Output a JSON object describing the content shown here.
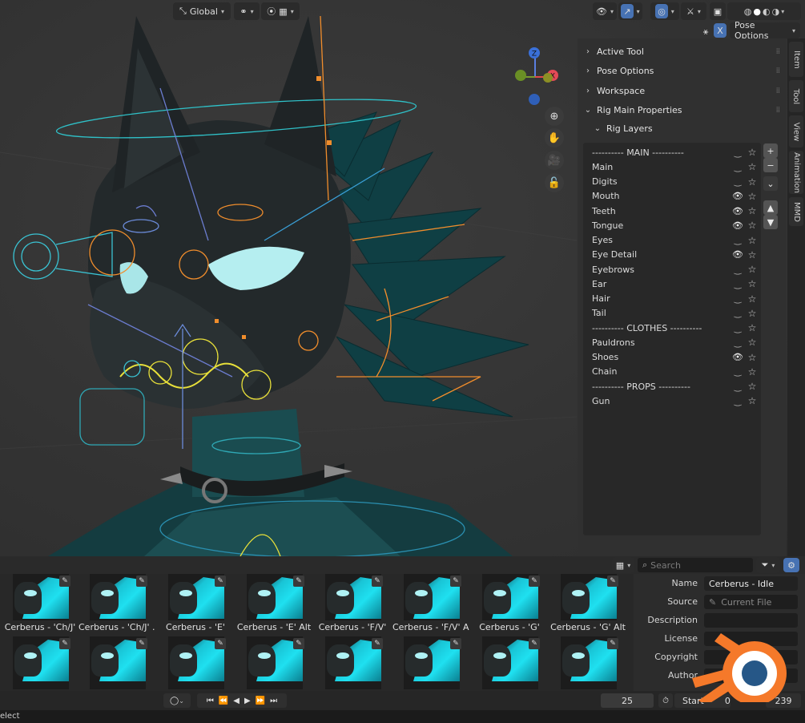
{
  "viewport": {
    "header": {
      "transform_orientation": "Global",
      "pose_options_label": "Pose Options",
      "x_mirror_label": "X"
    },
    "gizmo": {
      "x_label": "X",
      "y_label": "Y",
      "z_label": "Z"
    }
  },
  "sidebar": {
    "panels": [
      {
        "label": "Active Tool",
        "expanded": false
      },
      {
        "label": "Pose Options",
        "expanded": false
      },
      {
        "label": "Workspace",
        "expanded": false
      },
      {
        "label": "Rig Main Properties",
        "expanded": true
      }
    ],
    "subpanel": "Rig Layers",
    "layers": [
      {
        "label": "---------- MAIN ----------",
        "visible": false
      },
      {
        "label": "Main",
        "visible": false
      },
      {
        "label": "Digits",
        "visible": false
      },
      {
        "label": "Mouth",
        "visible": true
      },
      {
        "label": "Teeth",
        "visible": true
      },
      {
        "label": "Tongue",
        "visible": true
      },
      {
        "label": "Eyes",
        "visible": false
      },
      {
        "label": "Eye Detail",
        "visible": true
      },
      {
        "label": "Eyebrows",
        "visible": false
      },
      {
        "label": "Ear",
        "visible": false
      },
      {
        "label": "Hair",
        "visible": false
      },
      {
        "label": "Tail",
        "visible": false
      },
      {
        "label": "---------- CLOTHES ----------",
        "visible": false
      },
      {
        "label": "Pauldrons",
        "visible": false
      },
      {
        "label": "Shoes",
        "visible": true
      },
      {
        "label": "Chain",
        "visible": false
      },
      {
        "label": "---------- PROPS ----------",
        "visible": false
      },
      {
        "label": "Gun",
        "visible": false
      }
    ],
    "tabs": [
      "Item",
      "Tool",
      "View",
      "Animation",
      "MMD"
    ]
  },
  "asset_browser": {
    "search_placeholder": "Search",
    "row1": [
      "Cerberus - 'Ch/J'",
      "Cerberus - 'Ch/J' ...",
      "Cerberus - 'E'",
      "Cerberus - 'E' Alt",
      "Cerberus - 'F/V'",
      "Cerberus - 'F/V' Alt",
      "Cerberus - 'G'",
      "Cerberus - 'G' Alt"
    ],
    "metadata": {
      "name_label": "Name",
      "name_value": "Cerberus - Idle",
      "source_label": "Source",
      "source_value": "Current File",
      "description_label": "Description",
      "license_label": "License",
      "copyright_label": "Copyright",
      "author_label": "Author"
    }
  },
  "timeline": {
    "current_frame": "25",
    "start_label": "Start",
    "start_value": "0",
    "end_value": "239"
  },
  "statusbar": {
    "text": "elect"
  },
  "colors": {
    "accent": "#4772b3",
    "logo_orange": "#f5792a",
    "logo_blue": "#265787",
    "character_teal": "#1a5a5f"
  }
}
